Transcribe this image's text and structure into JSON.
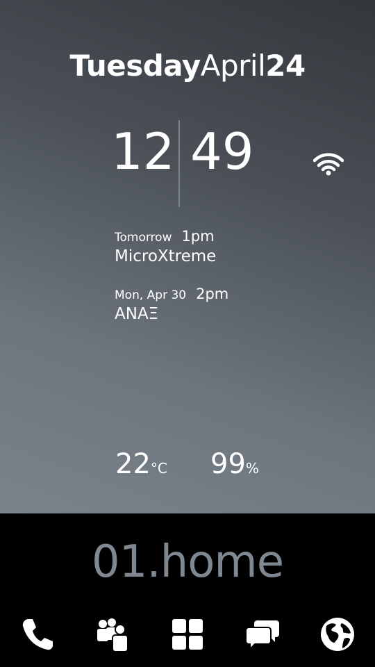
{
  "date": {
    "weekday": "Tuesday",
    "month": "April",
    "day": "24"
  },
  "clock": {
    "hours": "12",
    "minutes": "49"
  },
  "events": [
    {
      "when": "Tomorrow",
      "time": "1pm",
      "title": "MicroXtreme"
    },
    {
      "when": "Mon, Apr 30",
      "time": "2pm",
      "title": "ANAΞ"
    }
  ],
  "weather": {
    "temperature": "22",
    "temperature_unit": "°C",
    "humidity": "99",
    "humidity_unit": "%"
  },
  "screen": {
    "label": "01.home"
  },
  "dock": {
    "icons": [
      "phone-icon",
      "contacts-icon",
      "apps-grid-icon",
      "messages-icon",
      "browser-globe-icon"
    ]
  },
  "colors": {
    "accent_text": "#7f8891",
    "divider": "#7a858f"
  }
}
